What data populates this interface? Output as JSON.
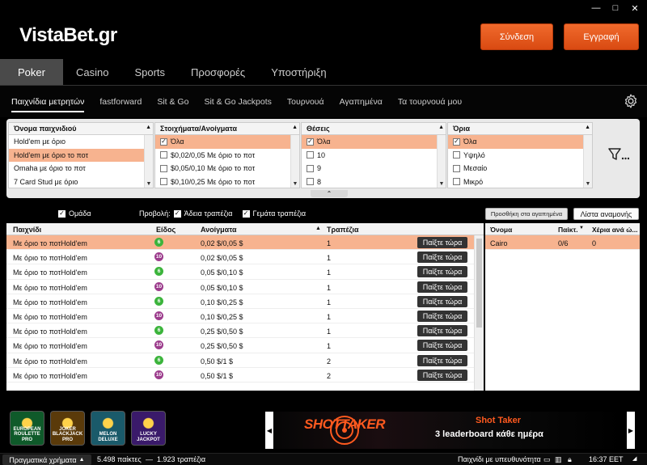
{
  "window": {
    "minimize": "—",
    "maximize": "□",
    "close": "✕"
  },
  "header": {
    "logo": "VistaBet.gr",
    "login": "Σύνδεση",
    "register": "Εγγραφή"
  },
  "main_tabs": [
    "Poker",
    "Casino",
    "Sports",
    "Προσφορές",
    "Υποστήριξη"
  ],
  "sub_tabs": [
    "Παιχνίδια μετρητών",
    "fastforward",
    "Sit & Go",
    "Sit & Go Jackpots",
    "Τουρνουά",
    "Αγαπημένα",
    "Τα τουρνουά μου"
  ],
  "filters": {
    "game_type": {
      "header": "Όνομα παιχνιδιού",
      "items": [
        "Hold'em με όριο",
        "Hold'em με όριο το ποτ",
        "Omaha με όριο το ποτ",
        "7 Card Stud με όριο"
      ],
      "selected": 1
    },
    "stakes": {
      "header": "Στοιχήματα/Ανοίγματα",
      "items": [
        "Όλα",
        "$0,02/0,05 Με όριο το ποτ",
        "$0,05/0,10 Με όριο το ποτ",
        "$0,10/0,25 Με όριο το ποτ"
      ],
      "checked": [
        true,
        false,
        false,
        false
      ]
    },
    "seats": {
      "header": "Θέσεις",
      "items": [
        "Όλα",
        "10",
        "9",
        "8"
      ],
      "checked": [
        true,
        false,
        false,
        false
      ]
    },
    "limits": {
      "header": "Όρια",
      "items": [
        "Όλα",
        "Υψηλό",
        "Μεσαίο",
        "Μικρό"
      ],
      "checked": [
        true,
        false,
        false,
        false
      ]
    }
  },
  "options": {
    "group_label": "Ομάδα",
    "view_label": "Προβολή:",
    "empty_label": "Άδεια τραπέζια",
    "full_label": "Γεμάτα τραπέζια",
    "add_favorites": "Προσθήκη στα αγαπημένα",
    "waiting_list": "Λίστα αναμονής"
  },
  "table": {
    "headers": {
      "game": "Παιχνίδι",
      "type": "Είδος",
      "stakes": "Ανοίγματα",
      "tables": "Τραπέζια"
    },
    "play_label": "Παίξτε τώρα",
    "rows": [
      {
        "game": "Με όριο το ποτHold'em",
        "type": "6",
        "stakes": "0,02 $/0,05 $",
        "tables": "1"
      },
      {
        "game": "Με όριο το ποτHold'em",
        "type": "10",
        "stakes": "0,02 $/0,05 $",
        "tables": "1"
      },
      {
        "game": "Με όριο το ποτHold'em",
        "type": "6",
        "stakes": "0,05 $/0,10 $",
        "tables": "1"
      },
      {
        "game": "Με όριο το ποτHold'em",
        "type": "10",
        "stakes": "0,05 $/0,10 $",
        "tables": "1"
      },
      {
        "game": "Με όριο το ποτHold'em",
        "type": "6",
        "stakes": "0,10 $/0,25 $",
        "tables": "1"
      },
      {
        "game": "Με όριο το ποτHold'em",
        "type": "10",
        "stakes": "0,10 $/0,25 $",
        "tables": "1"
      },
      {
        "game": "Με όριο το ποτHold'em",
        "type": "6",
        "stakes": "0,25 $/0,50 $",
        "tables": "1"
      },
      {
        "game": "Με όριο το ποτHold'em",
        "type": "10",
        "stakes": "0,25 $/0,50 $",
        "tables": "1"
      },
      {
        "game": "Με όριο το ποτHold'em",
        "type": "6",
        "stakes": "0,50 $/1 $",
        "tables": "2"
      },
      {
        "game": "Με όριο το ποτHold'em",
        "type": "10",
        "stakes": "0,50 $/1 $",
        "tables": "2"
      }
    ],
    "selected_row": 0
  },
  "waiting": {
    "headers": {
      "name": "Όνομα",
      "players": "Παίκτ.",
      "hands": "Χέρια ανά ώ..."
    },
    "rows": [
      {
        "name": "Cairo",
        "players": "0/6",
        "hands": "0"
      }
    ]
  },
  "promo": {
    "games": [
      {
        "label": "EUROPEAN ROULETTE PRO",
        "color": "#0f5a2a"
      },
      {
        "label": "JOKER BLACKJACK PRO",
        "color": "#5a3a0a"
      },
      {
        "label": "MELON DELUXE",
        "color": "#1a5a6a"
      },
      {
        "label": "LUCKY JACKPOT",
        "color": "#3a1a6a"
      }
    ],
    "banner_logo": "SHOTTAKER",
    "banner_title": "Shot Taker",
    "banner_subtitle": "3 leaderboard κάθε ημέρα"
  },
  "status": {
    "real_money": "Πραγματικά χρήματα",
    "players": "5.498 παίκτες",
    "tables": "1.923 τραπέζια",
    "responsible": "Παιχνίδι με υπευθυνότητα",
    "time": "16:37 EET"
  }
}
